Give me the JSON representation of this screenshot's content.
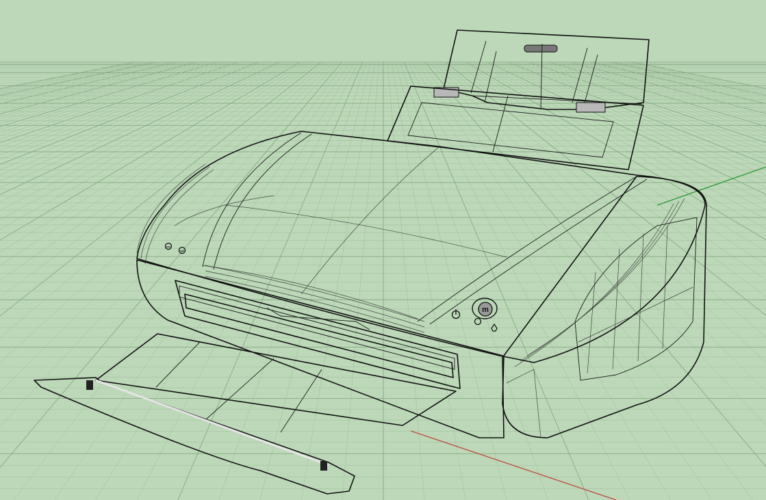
{
  "viewport": {
    "background_color": "#bcd8b8",
    "grid_minor_color": "#9ebb9a",
    "grid_major_color": "#87a884",
    "x_axis_color": "#c0524a",
    "y_axis_color": "#2f9a3a"
  },
  "model": {
    "shaded_mode": "shaded-with-isocurves",
    "body_color": "#8e8e8e",
    "top_color": "#6e6e6e",
    "tray_color": "#4f4f4f",
    "edge_color": "#101010",
    "button_logo_text": "m"
  }
}
